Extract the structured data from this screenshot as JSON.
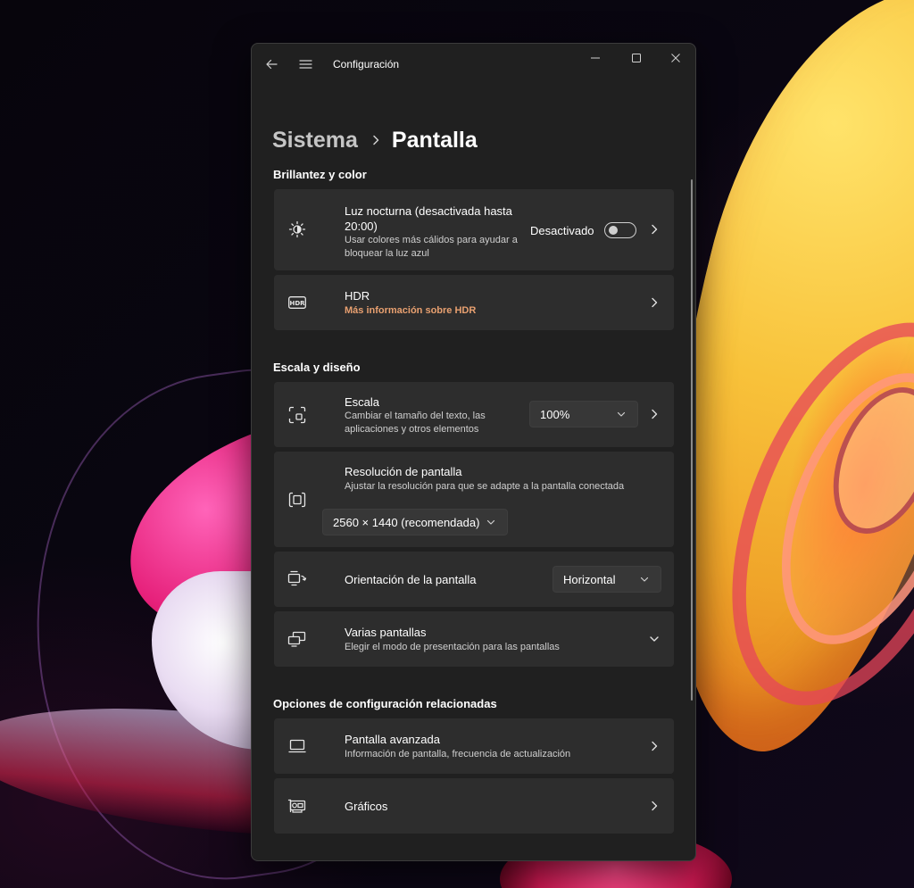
{
  "window": {
    "title": "Configuración",
    "accent_color": "#e8a070"
  },
  "breadcrumb": {
    "parent": "Sistema",
    "current": "Pantalla"
  },
  "sections": {
    "brightness": {
      "header": "Brillantez y color",
      "night_light": {
        "title": "Luz nocturna (desactivada hasta 20:00)",
        "subtitle": "Usar colores más cálidos para ayudar a bloquear la luz azul",
        "toggle_label": "Desactivado",
        "toggle_on": false,
        "icon": "brightness-icon"
      },
      "hdr": {
        "title": "HDR",
        "link": "Más información sobre HDR",
        "icon": "hdr-icon"
      }
    },
    "scale_layout": {
      "header": "Escala y diseño",
      "scale": {
        "title": "Escala",
        "subtitle": "Cambiar el tamaño del texto, las aplicaciones y otros elementos",
        "value": "100%",
        "icon": "scale-icon"
      },
      "resolution": {
        "title": "Resolución de pantalla",
        "subtitle": "Ajustar la resolución para que se adapte a la pantalla conectada",
        "value": "2560 × 1440 (recomendada)",
        "icon": "resolution-icon"
      },
      "orientation": {
        "title": "Orientación de la pantalla",
        "value": "Horizontal",
        "icon": "orientation-icon"
      },
      "multiple": {
        "title": "Varias pantallas",
        "subtitle": "Elegir el modo de presentación para las pantallas",
        "icon": "multiple-displays-icon"
      }
    },
    "related": {
      "header": "Opciones de configuración relacionadas",
      "advanced": {
        "title": "Pantalla avanzada",
        "subtitle": "Información de pantalla, frecuencia de actualización",
        "icon": "monitor-icon"
      },
      "graphics": {
        "title": "Gráficos",
        "icon": "graphics-card-icon"
      }
    }
  }
}
